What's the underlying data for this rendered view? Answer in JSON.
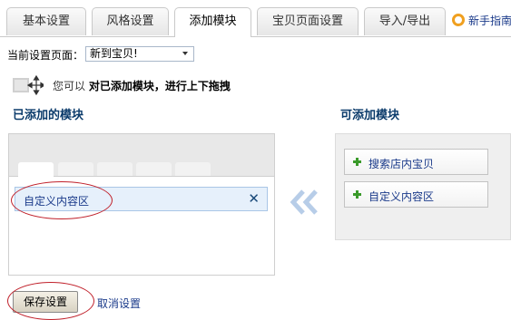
{
  "tabs": [
    {
      "label": "基本设置"
    },
    {
      "label": "风格设置"
    },
    {
      "label": "添加模块"
    },
    {
      "label": "宝贝页面设置"
    },
    {
      "label": "导入/导出"
    }
  ],
  "help_link": "新手指南",
  "current_page": {
    "label": "当前设置页面：",
    "value": "新到宝贝!"
  },
  "hint": {
    "prefix": "您可以",
    "bold": "对已添加模块，进行上下拖拽"
  },
  "added_section": {
    "title": "已添加的模块",
    "modules": [
      {
        "label": "自定义内容区"
      }
    ]
  },
  "available_section": {
    "title": "可添加模块",
    "modules": [
      {
        "label": "搜索店内宝贝"
      },
      {
        "label": "自定义内容区"
      }
    ]
  },
  "actions": {
    "save": "保存设置",
    "cancel": "取消设置"
  },
  "icons": {
    "drag": "drag-move-icon",
    "remove": "close-icon",
    "add": "plus-icon",
    "transfer": "double-chevron-left-icon",
    "help": "lifebuoy-icon"
  }
}
